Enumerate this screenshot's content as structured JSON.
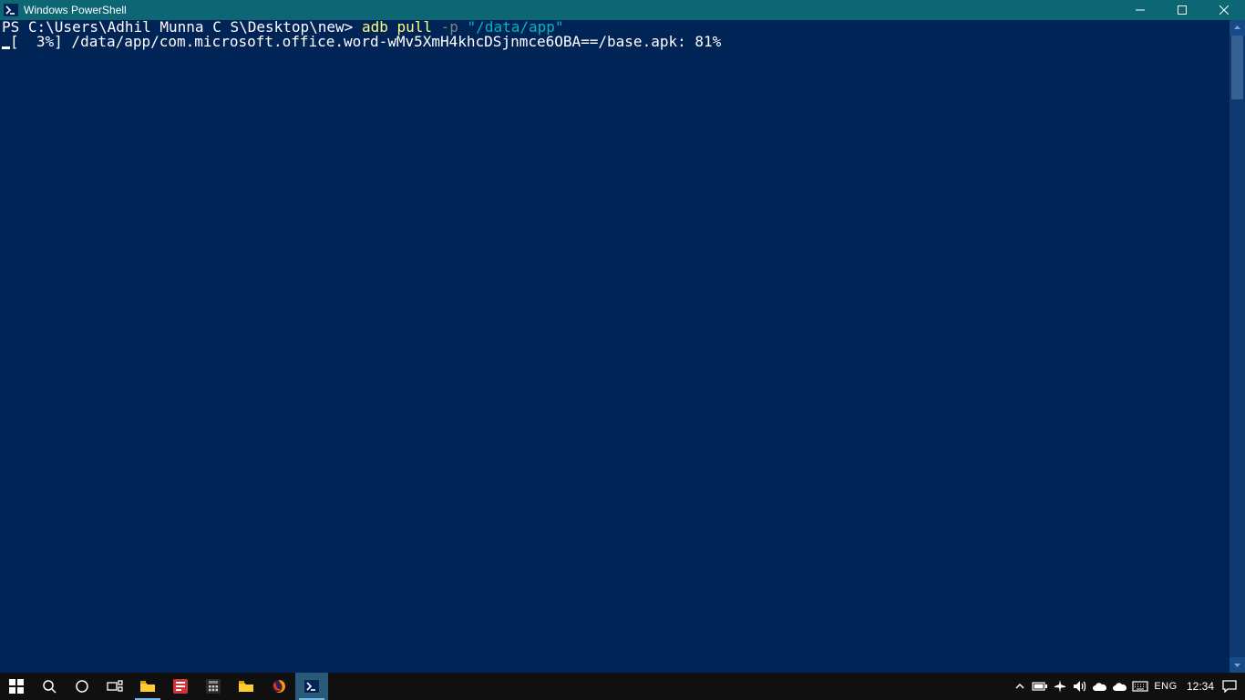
{
  "window": {
    "title": "Windows PowerShell"
  },
  "console": {
    "prompt_prefix": "PS C:\\Users\\Adhil Munna C S\\Desktop\\new> ",
    "command": "adb pull",
    "flag": " -p ",
    "argument": "\"/data/app\"",
    "output_line": "[  3%] /data/app/com.microsoft.office.word-wMv5XmH4khcDSjnmce6OBA==/base.apk: 81%"
  },
  "taskbar": {
    "language": "ENG",
    "clock": "12:34"
  }
}
